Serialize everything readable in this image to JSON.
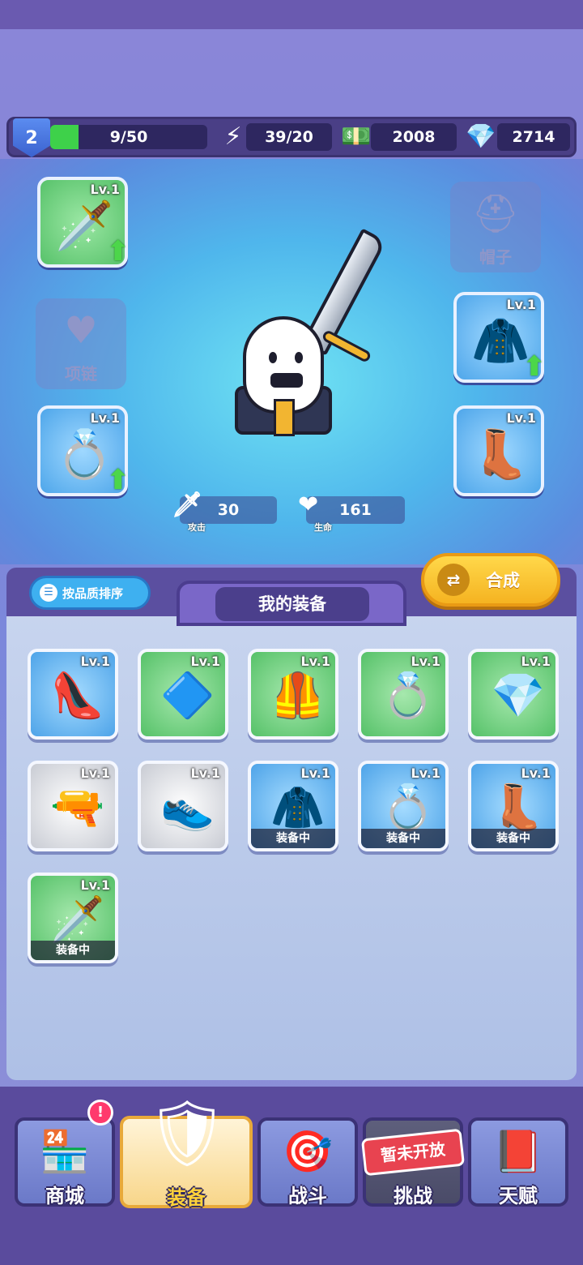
{
  "topbar": {
    "level": "2",
    "xp": "9/50",
    "xp_progress": 0.18,
    "energy": "39/20",
    "cash": "2008",
    "gems": "2714",
    "energy_icon": "lightning-bolt-icon",
    "cash_icon": "cash-stack-icon",
    "gem_icon": "diamond-icon"
  },
  "hero_slots": {
    "weapon": {
      "level": "Lv.1",
      "icon": "dagger-icon",
      "upgradable": true
    },
    "necklace": {
      "label": "项链",
      "empty": true
    },
    "ring": {
      "level": "Lv.1",
      "icon": "ring-icon",
      "upgradable": true
    },
    "hat": {
      "label": "帽子",
      "empty": true
    },
    "armor": {
      "level": "Lv.1",
      "icon": "armor-icon",
      "upgradable": true
    },
    "boots": {
      "level": "Lv.1",
      "icon": "boot-icon",
      "upgradable": false
    }
  },
  "stats": {
    "attack_label": "攻击",
    "attack": "30",
    "hp_label": "生命",
    "hp": "161"
  },
  "inventory": {
    "sort_label": "按品质排序",
    "title": "我的装备",
    "merge_label": "合成",
    "equipped_label": "装备中",
    "items": [
      {
        "level": "Lv.1",
        "icon": "heels-icon",
        "rarity": "blue",
        "equipped": false
      },
      {
        "level": "Lv.1",
        "icon": "amulet-icon",
        "rarity": "green",
        "equipped": false
      },
      {
        "level": "Lv.1",
        "icon": "gold-armor-icon",
        "rarity": "green",
        "equipped": false
      },
      {
        "level": "Lv.1",
        "icon": "ring-icon",
        "rarity": "green",
        "equipped": false
      },
      {
        "level": "Lv.1",
        "icon": "crystal-ring-icon",
        "rarity": "green",
        "equipped": false
      },
      {
        "level": "Lv.1",
        "icon": "revolver-icon",
        "rarity": "white",
        "equipped": false
      },
      {
        "level": "Lv.1",
        "icon": "sneaker-icon",
        "rarity": "white",
        "equipped": false
      },
      {
        "level": "Lv.1",
        "icon": "armor-icon",
        "rarity": "blue",
        "equipped": true
      },
      {
        "level": "Lv.1",
        "icon": "ring-icon",
        "rarity": "blue",
        "equipped": true
      },
      {
        "level": "Lv.1",
        "icon": "boot-icon",
        "rarity": "blue",
        "equipped": true
      },
      {
        "level": "Lv.1",
        "icon": "dagger-icon",
        "rarity": "green",
        "equipped": true
      }
    ]
  },
  "nav": {
    "shop": "商城",
    "equipment": "装备",
    "battle": "战斗",
    "challenge": "挑战",
    "talent": "天赋",
    "locked_label": "暂未开放",
    "badge": "!"
  }
}
